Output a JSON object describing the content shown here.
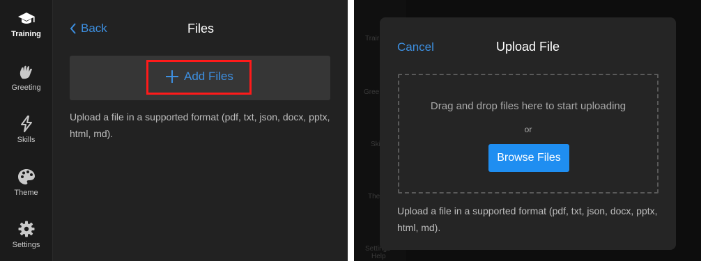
{
  "sidebar": {
    "items": [
      {
        "label": "Training",
        "icon": "graduation-cap-icon",
        "active": true
      },
      {
        "label": "Greeting",
        "icon": "waving-hand-icon",
        "active": false
      },
      {
        "label": "Skills",
        "icon": "lightning-bolt-icon",
        "active": false
      },
      {
        "label": "Theme",
        "icon": "palette-icon",
        "active": false
      },
      {
        "label": "Settings",
        "icon": "gear-icon",
        "active": false
      }
    ]
  },
  "files_page": {
    "back_label": "Back",
    "title": "Files",
    "add_files_label": "Add Files",
    "help_text": "Upload a file in a supported format (pdf, txt, json, docx, pptx, html, md)."
  },
  "upload_modal": {
    "cancel_label": "Cancel",
    "title": "Upload File",
    "dropzone_text": "Drag and drop files here to start uploading",
    "or_text": "or",
    "browse_label": "Browse Files",
    "help_text": "Upload a file in a supported format (pdf, txt, json, docx, pptx, html, md)."
  },
  "background_partial": {
    "sidebar_fragments": [
      "Trair",
      "Gree",
      "Ski",
      "The",
      "Settings",
      "Help"
    ]
  },
  "colors": {
    "accent": "#3d8fe0",
    "primary_button": "#1f8ef1",
    "highlight": "#ff1a1a",
    "panel_bg": "#222222",
    "sidebar_bg": "#1b1b1b"
  }
}
